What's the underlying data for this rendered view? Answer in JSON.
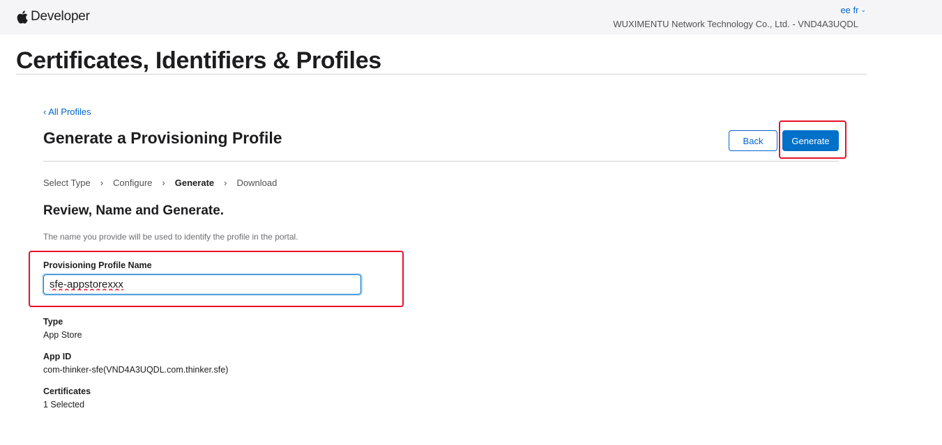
{
  "header": {
    "brand": "Developer",
    "user": "ee fr",
    "team": "WUXIMENTU Network Technology Co., Ltd. - VND4A3UQDL"
  },
  "page_title": "Certificates, Identifiers & Profiles",
  "back_link": "‹ All Profiles",
  "section_title": "Generate a Provisioning Profile",
  "buttons": {
    "back": "Back",
    "generate": "Generate"
  },
  "steps": [
    {
      "label": "Select Type",
      "current": false
    },
    {
      "label": "Configure",
      "current": false
    },
    {
      "label": "Generate",
      "current": true
    },
    {
      "label": "Download",
      "current": false
    }
  ],
  "sub_title": "Review, Name and Generate.",
  "description": "The name you provide will be used to identify the profile in the portal.",
  "form": {
    "name_label": "Provisioning Profile Name",
    "name_value": "sfe-appstorexxx"
  },
  "details": {
    "type_label": "Type",
    "type_value": "App Store",
    "app_id_label": "App ID",
    "app_id_value": "com-thinker-sfe(VND4A3UQDL.com.thinker.sfe)",
    "certificates_label": "Certificates",
    "certificates_value": "1 Selected"
  },
  "colors": {
    "accent": "#0070c9",
    "link": "#0066cc",
    "highlight": "#e8102a"
  }
}
